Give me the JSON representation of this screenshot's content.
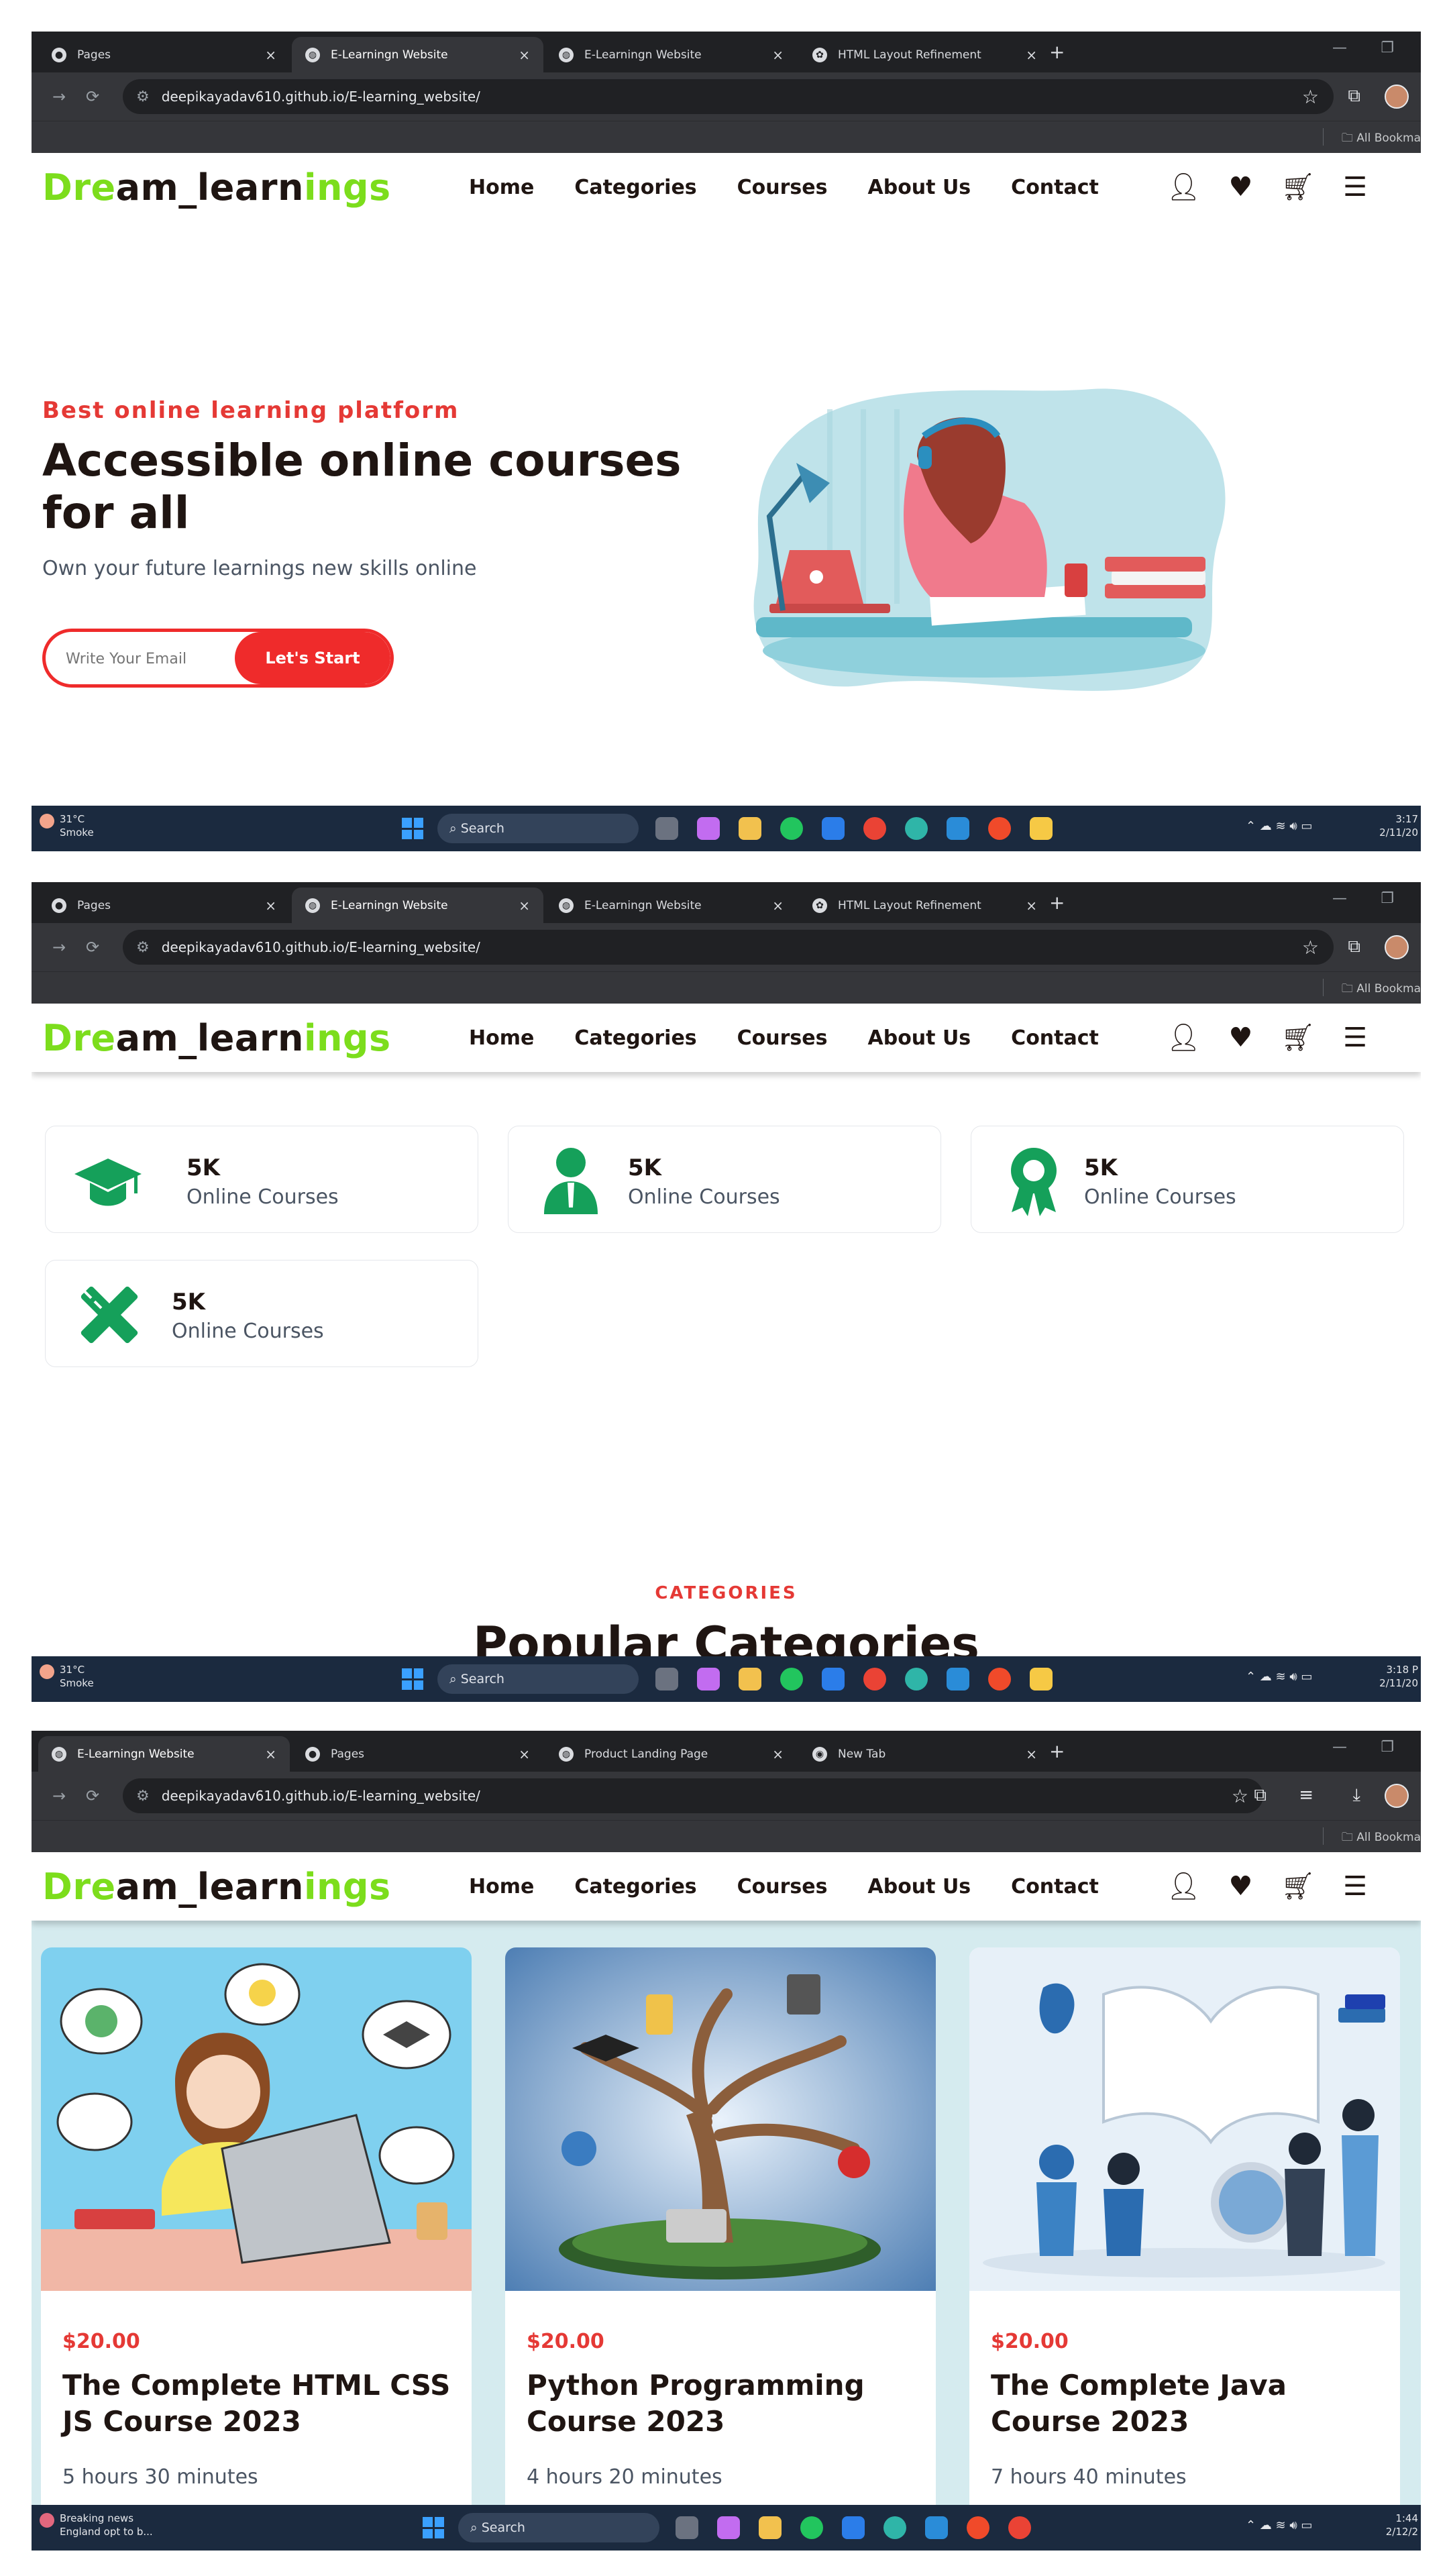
{
  "shots": [
    {
      "tabs": [
        {
          "label": "Pages",
          "active": false
        },
        {
          "label": "E-Learningn Website",
          "active": true
        },
        {
          "label": "E-Learningn Website",
          "active": false
        },
        {
          "label": "HTML Layout Refinement",
          "active": false
        }
      ],
      "url": "deepikayadav610.github.io/E-learning_website/",
      "taskbar": {
        "weather_temp": "31°C",
        "weather_desc": "Smoke",
        "search": "Search",
        "time": "3:17",
        "date": "2/11/20"
      }
    },
    {
      "tabs": [
        {
          "label": "Pages",
          "active": false
        },
        {
          "label": "E-Learningn Website",
          "active": true
        },
        {
          "label": "E-Learningn Website",
          "active": false
        },
        {
          "label": "HTML Layout Refinement",
          "active": false
        }
      ],
      "url": "deepikayadav610.github.io/E-learning_website/",
      "taskbar": {
        "weather_temp": "31°C",
        "weather_desc": "Smoke",
        "search": "Search",
        "time": "3:18 P",
        "date": "2/11/20"
      }
    },
    {
      "tabs": [
        {
          "label": "E-Learningn Website",
          "active": true
        },
        {
          "label": "Pages",
          "active": false
        },
        {
          "label": "Product Landing Page",
          "active": false
        },
        {
          "label": "New Tab",
          "active": false
        }
      ],
      "url": "deepikayadav610.github.io/E-learning_website/",
      "taskbar": {
        "weather_temp": "Breaking news",
        "weather_desc": "England opt to b...",
        "search": "Search",
        "time": "1:44",
        "date": "2/12/2"
      }
    }
  ],
  "bookmarks_label": "All Bookma",
  "site": {
    "logo": {
      "part1": "Dre",
      "part2": "am_learn",
      "part3": "ings"
    },
    "nav": [
      "Home",
      "Categories",
      "Courses",
      "About Us",
      "Contact"
    ],
    "header_icons": [
      "user-icon",
      "heart-icon",
      "cart-icon",
      "menu-icon"
    ]
  },
  "hero": {
    "kicker": "Best online learning platform",
    "title": "Accessible online courses for all",
    "subtitle": "Own your future learnings new skills online",
    "email_placeholder": "Write Your Email",
    "cta": "Let's Start"
  },
  "stats": [
    {
      "icon": "graduation-cap-icon",
      "number": "5K",
      "label": "Online Courses"
    },
    {
      "icon": "teacher-icon",
      "number": "5K",
      "label": "Online Courses"
    },
    {
      "icon": "award-ribbon-icon",
      "number": "5K",
      "label": "Online Courses"
    },
    {
      "icon": "pencil-ruler-icon",
      "number": "5K",
      "label": "Online Courses"
    }
  ],
  "categories_section": {
    "kicker": "CATEGORIES",
    "title": "Popular Categories"
  },
  "courses": [
    {
      "price": "$20.00",
      "title": "The Complete HTML CSS JS Course 2023",
      "duration": "5 hours 30 minutes"
    },
    {
      "price": "$20.00",
      "title": "Python Programming Course 2023",
      "duration": "4 hours 20 minutes"
    },
    {
      "price": "$20.00",
      "title": "The Complete Java Course 2023",
      "duration": "7 hours 40 minutes"
    }
  ],
  "colors": {
    "accent_red": "#ef2b2b",
    "logo_green": "#7cdd1c",
    "icon_green": "#15a05a",
    "dark_text": "#1f1512"
  }
}
